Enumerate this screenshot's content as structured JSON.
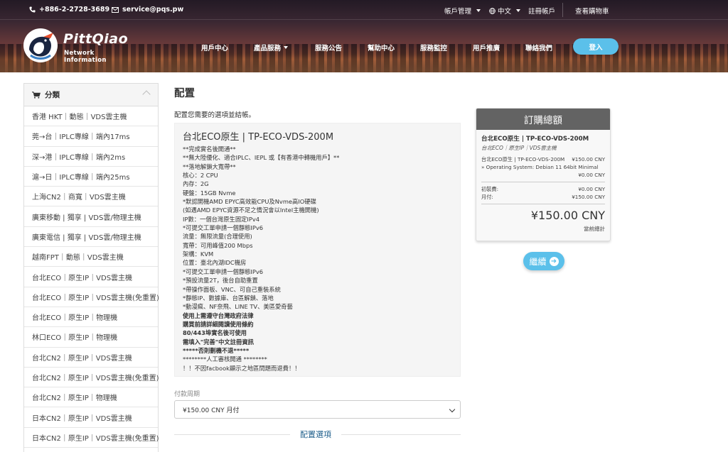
{
  "topbar": {
    "phone": "+886-2-2728-3689",
    "email": "service@pqs.pw",
    "account_mgmt": "帳戶管理",
    "language": "中文",
    "register": "註冊帳戶",
    "cart": "查看購物車"
  },
  "brand": {
    "name": "PittQiao",
    "subtitle": "Network Information"
  },
  "nav": {
    "items": [
      "用戶中心",
      "產品服務",
      "服務公告",
      "幫助中心",
      "服務監控",
      "用戶推廣",
      "聯絡我們"
    ],
    "login": "登入"
  },
  "sidebar": {
    "title": "分類",
    "items": [
      "香港 HKT｜動態｜VDS雲主機",
      "莞→台｜IPLC專線｜端內17ms",
      "深→港｜IPLC專線｜端內2ms",
      "滬→日｜IPLC專線｜端內25ms",
      "上海CN2｜商寬｜VDS雲主機",
      "廣東移動 | 獨享 | VDS雲/物理主機",
      "廣東電信 | 獨享 | VDS雲/物理主機",
      "越南FPT｜動態｜VDS雲主機",
      "台北ECO｜原生IP｜VDS雲主機",
      "台北ECO｜原生IP｜VDS雲主機(免重置)",
      "台北ECO｜原生IP｜物理機",
      "林口ECO｜原生IP｜物理機",
      "台北CN2｜原生IP｜VDS雲主機",
      "台北CN2｜原生IP｜VDS雲主機(免重置)",
      "台北CN2｜原生IP｜物理機",
      "日本CN2｜原生IP｜VDS雲主機",
      "日本CN2｜原生IP｜VDS雲主機(免重置)"
    ]
  },
  "main": {
    "title": "配置",
    "description": "配置您需要的選項並結帳。",
    "product_title": "台北ECO原生 | TP-ECO-VDS-200M",
    "product_lines": [
      {
        "text": "**完成實名後開通**",
        "bold": false
      },
      {
        "text": "**無大陸優化、適合IPLC、IEPL 或【有香港中轉機用戶】**",
        "bold": false
      },
      {
        "text": "**落地解鎖大寬帶**",
        "bold": false
      },
      {
        "text": "核心：2 CPU",
        "bold": false
      },
      {
        "text": "內存：2G",
        "bold": false
      },
      {
        "text": "硬盤：15GB Nvme",
        "bold": false
      },
      {
        "text": "*默認開機AMD EPYC高效能CPU及Nvme高IO硬碟",
        "bold": false
      },
      {
        "text": "(如遇AMD EPYC資源不足之情況會以Intel主機開機)",
        "bold": false
      },
      {
        "text": "IP數：一個台灣原生固定IPv4",
        "bold": false
      },
      {
        "text": "*可提交工單申請一個靜態IPv6",
        "bold": false
      },
      {
        "text": "流量：無限流量(合理使用)",
        "bold": false
      },
      {
        "text": "寬帶：可用峰值200 Mbps",
        "bold": false
      },
      {
        "text": "架構：KVM",
        "bold": false
      },
      {
        "text": "位置：臺北內湖IDC機房",
        "bold": false
      },
      {
        "text": "*可提交工單申請一個靜態IPv6",
        "bold": false
      },
      {
        "text": "*預設流量2T，後台自助重置",
        "bold": false
      },
      {
        "text": "*帶操作面板、VNC、可自己重裝系統",
        "bold": false
      },
      {
        "text": "*靜態IP、數據庫、台區解鎖、落地",
        "bold": false
      },
      {
        "text": "*動漫瘋、NF奈飛、LINE TV、美區愛奇藝",
        "bold": false
      },
      {
        "text": "使用上需遵守台灣政府法律",
        "bold": true
      },
      {
        "text": "購買前請詳細閱讀使用條約",
        "bold": true
      },
      {
        "text": "80/443埠實名後可使用",
        "bold": true
      },
      {
        "text": "需填入\"完善\"中文註冊資訊",
        "bold": true
      },
      {
        "text": "*****否則刪機不退*****",
        "bold": true
      },
      {
        "text": "********人工審核開通 ********",
        "bold": false
      },
      {
        "text": "！！不因facbook顯示之地區問題而退費！！",
        "bold": false
      }
    ],
    "billing_cycle_label": "付款周期",
    "billing_cycle_value": "¥150.00 CNY 月付",
    "config_options_title": "配置選項"
  },
  "summary": {
    "title": "訂購總額",
    "product_name": "台北ECO原生 | TP-ECO-VDS-200M",
    "product_group": "台北ECO｜原生IP｜VDS雲主機",
    "line_item": "台北ECO原生 | TP-ECO-VDS-200M",
    "line_item_price": "¥150.00 CNY",
    "os_option": "» Operating System: Debian 11 64bit Minimal",
    "os_price": "¥0.00 CNY",
    "setup_label": "初裝費:",
    "setup_price": "¥0.00 CNY",
    "monthly_label": "月付:",
    "monthly_price": "¥150.00 CNY",
    "total": "¥150.00 CNY",
    "total_label": "當前總計",
    "continue": "繼續"
  }
}
